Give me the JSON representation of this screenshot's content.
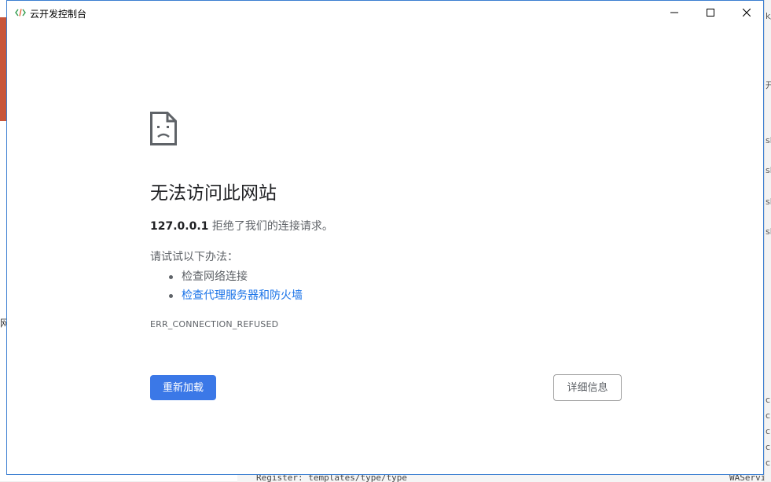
{
  "window": {
    "title": "云开发控制台",
    "icon": "code-brackets-icon",
    "accent_color": "#3c7fd1"
  },
  "background": {
    "left_text": "网",
    "right_rows": [
      "k/",
      "开",
      "",
      "sh",
      "sh",
      "sh",
      "sh",
      "",
      "",
      "",
      "",
      "c",
      "c",
      "c",
      "c",
      "c"
    ],
    "bottom_left": "Register: templates/type/type",
    "bottom_right": "WAService"
  },
  "error": {
    "title": "无法访问此网站",
    "host": "127.0.0.1",
    "description": " 拒绝了我们的连接请求。",
    "suggestions_heading": "请试试以下办法：",
    "suggestions": [
      {
        "text": "检查网络连接",
        "link": false
      },
      {
        "text": "检查代理服务器和防火墙",
        "link": true
      }
    ],
    "code": "ERR_CONNECTION_REFUSED",
    "reload_label": "重新加载",
    "details_label": "详细信息",
    "reload_color": "#3b78e7",
    "link_color": "#1a73e8"
  }
}
